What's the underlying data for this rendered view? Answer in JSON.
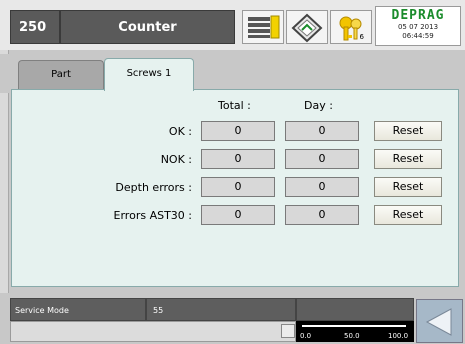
{
  "header": {
    "number": "250",
    "title": "Counter",
    "key_badge": "6",
    "logo": "DEPRAG",
    "date": "05 07 2013",
    "time": "06:44:59",
    "icons": [
      "menu-list-icon",
      "nav-diamond-icon",
      "keys-icon"
    ]
  },
  "tabs": [
    {
      "label": "Part",
      "active": false
    },
    {
      "label": "Screws 1",
      "active": true
    }
  ],
  "table": {
    "columns": [
      "Total :",
      "Day :"
    ],
    "reset_label": "Reset",
    "rows": [
      {
        "label": "OK :",
        "total": "0",
        "day": "0"
      },
      {
        "label": "NOK :",
        "total": "0",
        "day": "0"
      },
      {
        "label": "Depth errors :",
        "total": "0",
        "day": "0"
      },
      {
        "label": "Errors AST30 :",
        "total": "0",
        "day": "0"
      }
    ]
  },
  "footer": {
    "mode": "Service Mode",
    "value": "55",
    "gauge_ticks": [
      "0.0",
      "50.0",
      "100.0"
    ],
    "gauge_level": 1.0
  },
  "colors": {
    "panel_bg": "#e6f2ef",
    "header_dark": "#5a5a5a",
    "logo_green": "#1b8c2c",
    "back_button": "#a6b8c8"
  }
}
